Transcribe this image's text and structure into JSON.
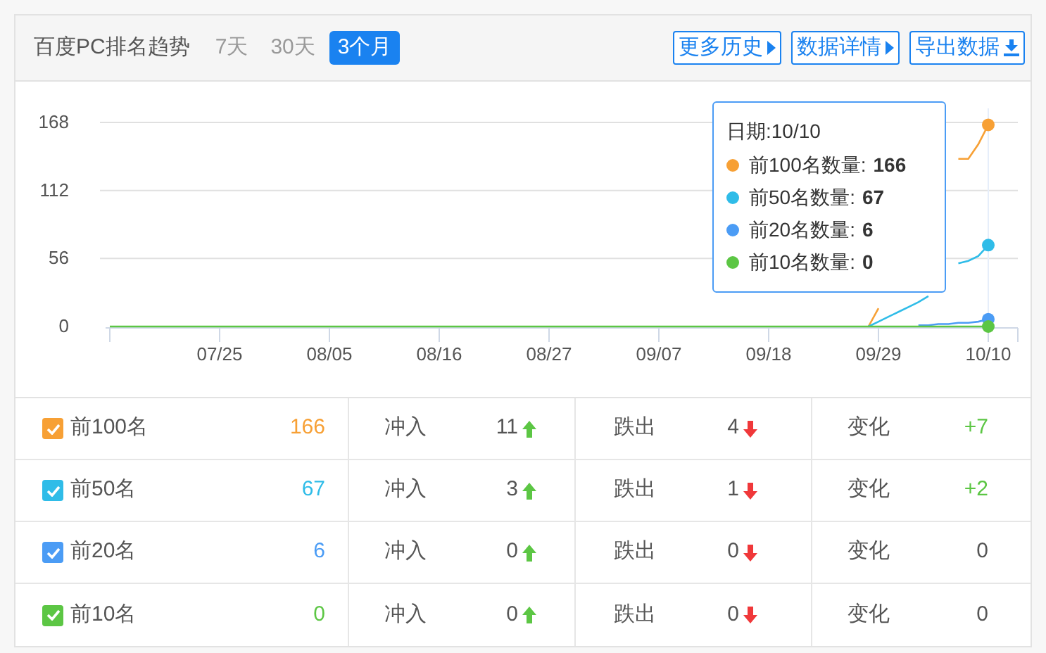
{
  "header": {
    "title": "百度PC排名趋势",
    "ranges": [
      {
        "label": "7天",
        "selected": false
      },
      {
        "label": "30天",
        "selected": false
      },
      {
        "label": "3个月",
        "selected": true
      }
    ],
    "actions": [
      {
        "label": "更多历史",
        "kind": "more"
      },
      {
        "label": "数据详情",
        "kind": "more"
      },
      {
        "label": "导出数据",
        "kind": "download"
      }
    ]
  },
  "chart": {
    "chart_data": {
      "type": "line",
      "categories": [
        null,
        null,
        null,
        null,
        null,
        null,
        null,
        null,
        null,
        null,
        null,
        "07/25",
        null,
        null,
        null,
        null,
        null,
        null,
        null,
        null,
        null,
        null,
        "08/05",
        null,
        null,
        null,
        null,
        null,
        null,
        null,
        null,
        null,
        null,
        "08/16",
        null,
        null,
        null,
        null,
        null,
        null,
        null,
        null,
        null,
        null,
        "08/27",
        null,
        null,
        null,
        null,
        null,
        null,
        null,
        null,
        null,
        null,
        "09/07",
        null,
        null,
        null,
        null,
        null,
        null,
        null,
        null,
        null,
        null,
        "09/18",
        null,
        null,
        null,
        null,
        null,
        null,
        null,
        null,
        null,
        null,
        "09/29",
        null,
        null,
        null,
        null,
        null,
        null,
        null,
        null,
        null,
        null,
        "10/10"
      ],
      "ylim": [
        0,
        168
      ],
      "yticks": [
        0,
        56,
        112,
        168
      ],
      "series": [
        {
          "color": "#f7a035",
          "values": [
            null,
            null,
            null,
            null,
            null,
            null,
            null,
            null,
            null,
            null,
            null,
            null,
            null,
            null,
            null,
            null,
            null,
            null,
            null,
            null,
            null,
            null,
            null,
            null,
            null,
            null,
            null,
            null,
            null,
            null,
            null,
            null,
            null,
            null,
            null,
            null,
            null,
            null,
            null,
            null,
            null,
            null,
            null,
            null,
            null,
            null,
            null,
            null,
            null,
            null,
            null,
            null,
            null,
            null,
            null,
            null,
            null,
            null,
            null,
            null,
            null,
            null,
            null,
            null,
            null,
            null,
            null,
            null,
            null,
            null,
            null,
            null,
            null,
            null,
            null,
            null,
            0,
            15,
            null,
            null,
            null,
            null,
            null,
            null,
            null,
            138,
            138,
            150,
            166
          ]
        },
        {
          "color": "#2fbce8",
          "values": [
            null,
            null,
            null,
            null,
            null,
            null,
            null,
            null,
            null,
            null,
            null,
            null,
            null,
            null,
            null,
            null,
            null,
            null,
            null,
            null,
            null,
            null,
            null,
            null,
            null,
            null,
            null,
            null,
            null,
            null,
            null,
            null,
            null,
            null,
            null,
            null,
            null,
            null,
            null,
            null,
            null,
            null,
            null,
            null,
            null,
            null,
            null,
            null,
            null,
            null,
            null,
            null,
            null,
            null,
            null,
            null,
            null,
            null,
            null,
            null,
            null,
            null,
            null,
            null,
            null,
            null,
            null,
            null,
            null,
            null,
            null,
            null,
            null,
            null,
            null,
            null,
            0,
            4,
            8,
            12,
            16,
            20,
            25,
            null,
            null,
            52,
            54,
            58,
            67
          ]
        },
        {
          "color": "#4b9cf5",
          "values": [
            null,
            null,
            null,
            null,
            null,
            null,
            null,
            null,
            null,
            null,
            null,
            null,
            null,
            null,
            null,
            null,
            null,
            null,
            null,
            null,
            null,
            null,
            null,
            null,
            null,
            null,
            null,
            null,
            null,
            null,
            null,
            null,
            null,
            null,
            null,
            null,
            null,
            null,
            null,
            null,
            null,
            null,
            null,
            null,
            null,
            null,
            null,
            null,
            null,
            null,
            null,
            null,
            null,
            null,
            null,
            null,
            null,
            null,
            null,
            null,
            null,
            null,
            null,
            null,
            null,
            null,
            null,
            null,
            null,
            null,
            null,
            null,
            null,
            null,
            null,
            null,
            null,
            null,
            null,
            null,
            null,
            1,
            1,
            2,
            2,
            3,
            3,
            4,
            6
          ]
        },
        {
          "color": "#5cc644",
          "values": [
            0,
            0,
            0,
            0,
            0,
            0,
            0,
            0,
            0,
            0,
            0,
            0,
            0,
            0,
            0,
            0,
            0,
            0,
            0,
            0,
            0,
            0,
            0,
            0,
            0,
            0,
            0,
            0,
            0,
            0,
            0,
            0,
            0,
            0,
            0,
            0,
            0,
            0,
            0,
            0,
            0,
            0,
            0,
            0,
            0,
            0,
            0,
            0,
            0,
            0,
            0,
            0,
            0,
            0,
            0,
            0,
            0,
            0,
            0,
            0,
            0,
            0,
            0,
            0,
            0,
            0,
            0,
            0,
            0,
            0,
            0,
            0,
            0,
            0,
            0,
            0,
            0,
            0,
            0,
            0,
            0,
            0,
            0,
            0,
            0,
            0,
            0,
            0,
            0
          ]
        }
      ]
    },
    "tooltip": {
      "date": "日期:10/10",
      "items": [
        {
          "label": "前100名数量:",
          "value": "166",
          "color": "#f7a035"
        },
        {
          "label": "前50名数量:",
          "value": "67",
          "color": "#2fbce8"
        },
        {
          "label": "前20名数量:",
          "value": "6",
          "color": "#4b9cf5"
        },
        {
          "label": "前10名数量:",
          "value": "0",
          "color": "#5cc644"
        }
      ]
    }
  },
  "table": {
    "rows": [
      {
        "name": "前100名",
        "checked": true,
        "color": "#f7a035",
        "count": "166",
        "in_label": "冲入",
        "in": "11",
        "out_label": "跌出",
        "out": "4",
        "change_label": "变化",
        "change": {
          "text": "+7",
          "color": "#5cc644"
        }
      },
      {
        "name": "前50名",
        "checked": true,
        "color": "#2fbce8",
        "count": "67",
        "in_label": "冲入",
        "in": "3",
        "out_label": "跌出",
        "out": "1",
        "change_label": "变化",
        "change": {
          "text": "+2",
          "color": "#5cc644"
        }
      },
      {
        "name": "前20名",
        "checked": true,
        "color": "#4b9cf5",
        "count": "6",
        "in_label": "冲入",
        "in": "0",
        "out_label": "跌出",
        "out": "0",
        "change_label": "变化",
        "change": {
          "text": "0",
          "color": "#555555"
        }
      },
      {
        "name": "前10名",
        "checked": true,
        "color": "#5cc644",
        "count": "0",
        "in_label": "冲入",
        "in": "0",
        "out_label": "跌出",
        "out": "0",
        "change_label": "变化",
        "change": {
          "text": "0",
          "color": "#555555"
        }
      }
    ]
  }
}
